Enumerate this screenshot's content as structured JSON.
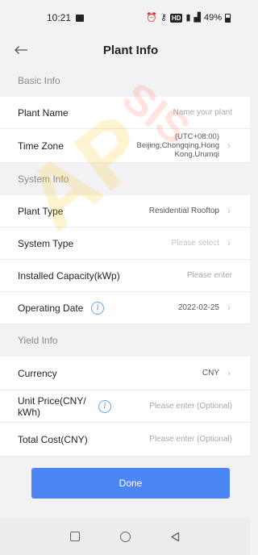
{
  "status_bar": {
    "time": "10:21",
    "battery": "49%",
    "hd_badge": "HD",
    "signal": "⁴ᴳ"
  },
  "header": {
    "title": "Plant Info"
  },
  "sections": {
    "basic": "Basic Info",
    "system": "System Info",
    "yield": "Yield Info"
  },
  "fields": {
    "plant_name": {
      "label": "Plant Name",
      "placeholder": "Name your plant"
    },
    "time_zone": {
      "label": "Time Zone",
      "value": "(UTC+08:00) Beijing,Chongqing,Hong Kong,Urumqi"
    },
    "plant_type": {
      "label": "Plant Type",
      "value": "Residential Rooftop"
    },
    "system_type": {
      "label": "System Type",
      "placeholder": "Please select"
    },
    "installed_capacity": {
      "label": "Installed Capacity(kWp)",
      "placeholder": "Please enter"
    },
    "operating_date": {
      "label": "Operating Date",
      "value": "2022-02-25"
    },
    "currency": {
      "label": "Currency",
      "value": "CNY"
    },
    "unit_price": {
      "label": "Unit Price(CNY/ kWh)",
      "placeholder": "Please enter (Optional)"
    },
    "total_cost": {
      "label": "Total Cost(CNY)",
      "placeholder": "Please enter (Optional)"
    }
  },
  "actions": {
    "done": "Done"
  },
  "colors": {
    "accent": "#4c86f5",
    "background": "#f2f2f4"
  },
  "watermark_marks": [
    "AP",
    "SIS"
  ]
}
